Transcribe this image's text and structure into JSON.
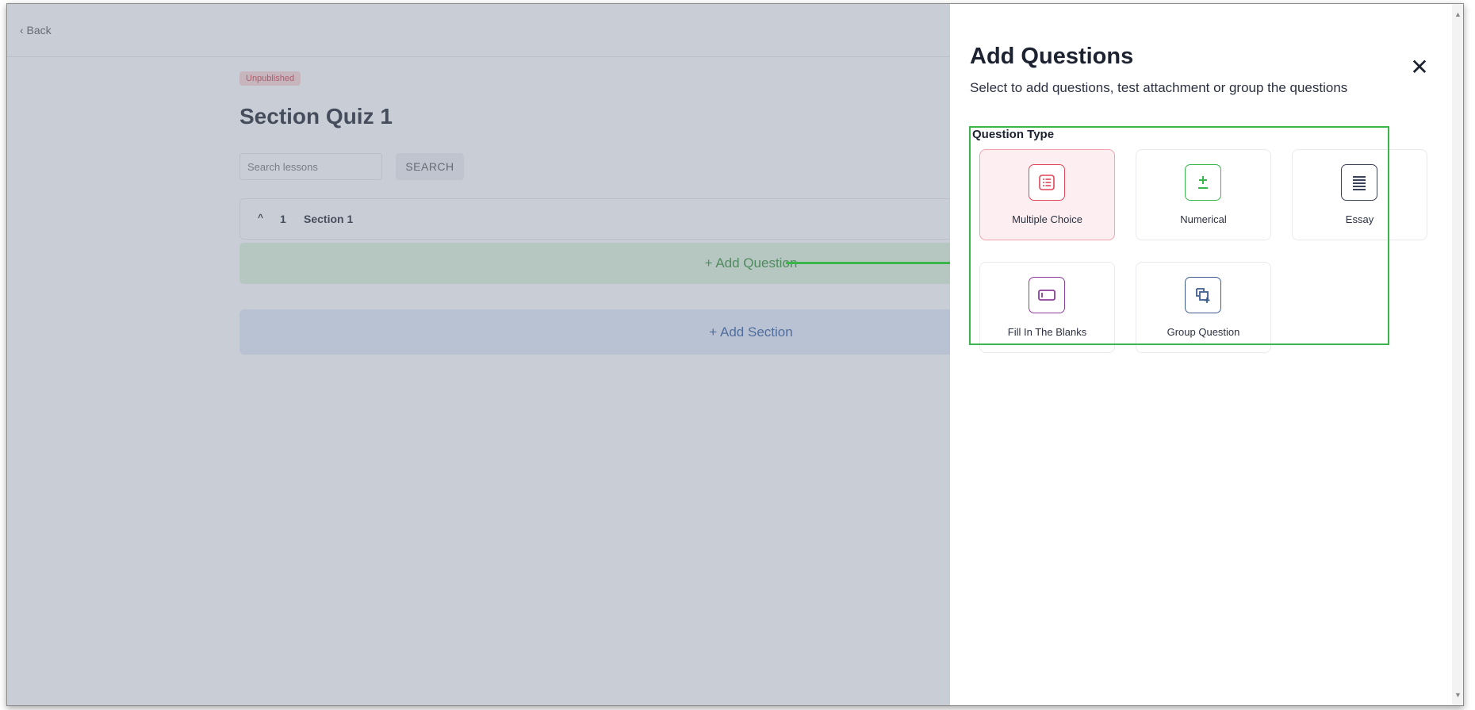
{
  "header": {
    "back_label": "‹ Back"
  },
  "quiz": {
    "status_badge": "Unpublished",
    "title": "Section Quiz 1",
    "search": {
      "placeholder": "Search lessons",
      "button_label": "SEARCH"
    },
    "section": {
      "number": "1",
      "label": "Section 1"
    },
    "add_question_label": "+ Add Question",
    "add_section_label": "+ Add Section"
  },
  "drawer": {
    "title": "Add Questions",
    "subtitle": "Select to add questions, test attachment or group the questions",
    "close_label": "✕",
    "question_type_label": "Question Type",
    "types": [
      {
        "label": "Multiple Choice",
        "icon": "list-icon",
        "color": "#e0475a",
        "selected": true
      },
      {
        "label": "Numerical",
        "icon": "plus-minus-icon",
        "color": "#3bb64a",
        "selected": false
      },
      {
        "label": "Essay",
        "icon": "text-lines-icon",
        "color": "#3c4257",
        "selected": false
      },
      {
        "label": "Fill In The Blanks",
        "icon": "blank-field-icon",
        "color": "#8e3d9b",
        "selected": false
      },
      {
        "label": "Group Question",
        "icon": "group-add-icon",
        "color": "#3e5d8f",
        "selected": false
      }
    ]
  },
  "colors": {
    "annotation": "#3bb64a",
    "badge": "#d23c45"
  }
}
